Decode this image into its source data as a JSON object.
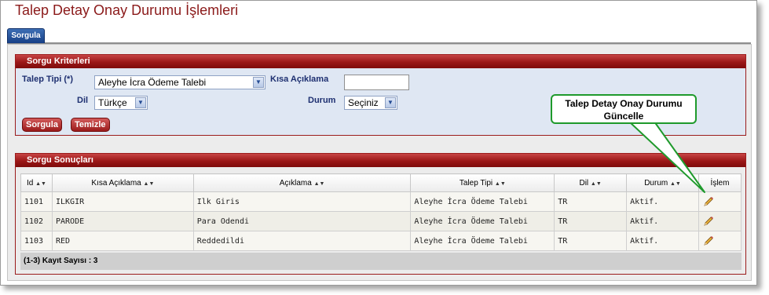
{
  "page": {
    "title": "Talep Detay Onay Durumu İşlemleri"
  },
  "tabs": [
    {
      "label": "Sorgula",
      "active": true
    }
  ],
  "criteria": {
    "header": "Sorgu Kriterleri",
    "talep_tipi": {
      "label": "Talep Tipi (*)",
      "value": "Aleyhe İcra Ödeme Talebi"
    },
    "kisa_aciklama": {
      "label": "Kısa Açıklama",
      "value": ""
    },
    "dil": {
      "label": "Dil",
      "value": "Türkçe"
    },
    "durum": {
      "label": "Durum",
      "value": "Seçiniz"
    },
    "buttons": {
      "search": "Sorgula",
      "clear": "Temizle"
    }
  },
  "results": {
    "header": "Sorgu Sonuçları",
    "columns": [
      "Id",
      "Kısa Açıklama",
      "Açıklama",
      "Talep Tipi",
      "Dil",
      "Durum",
      "İşlem"
    ],
    "rows": [
      {
        "id": "1101",
        "short": "ILKGIR",
        "desc": "Ilk Giris",
        "type": "Aleyhe İcra Ödeme Talebi",
        "lang": "TR",
        "status": "Aktif."
      },
      {
        "id": "1102",
        "short": "PARODE",
        "desc": "Para Odendi",
        "type": "Aleyhe İcra Ödeme Talebi",
        "lang": "TR",
        "status": "Aktif."
      },
      {
        "id": "1103",
        "short": "RED",
        "desc": "Reddedildi",
        "type": "Aleyhe İcra Ödeme Talebi",
        "lang": "TR",
        "status": "Aktif."
      }
    ],
    "footer": "(1-3) Kayıt Sayısı : 3"
  },
  "callout": {
    "line1": "Talep Detay Onay Durumu",
    "line2": "Güncelle"
  },
  "colors": {
    "section_header": "#9b1717",
    "title": "#8b1a1a",
    "callout_border": "#1f9a2c",
    "tab": "#1c4489"
  },
  "icons": {
    "edit": "pencil-icon",
    "sort": "sort-arrows-icon",
    "dropdown": "chevron-down-icon"
  }
}
